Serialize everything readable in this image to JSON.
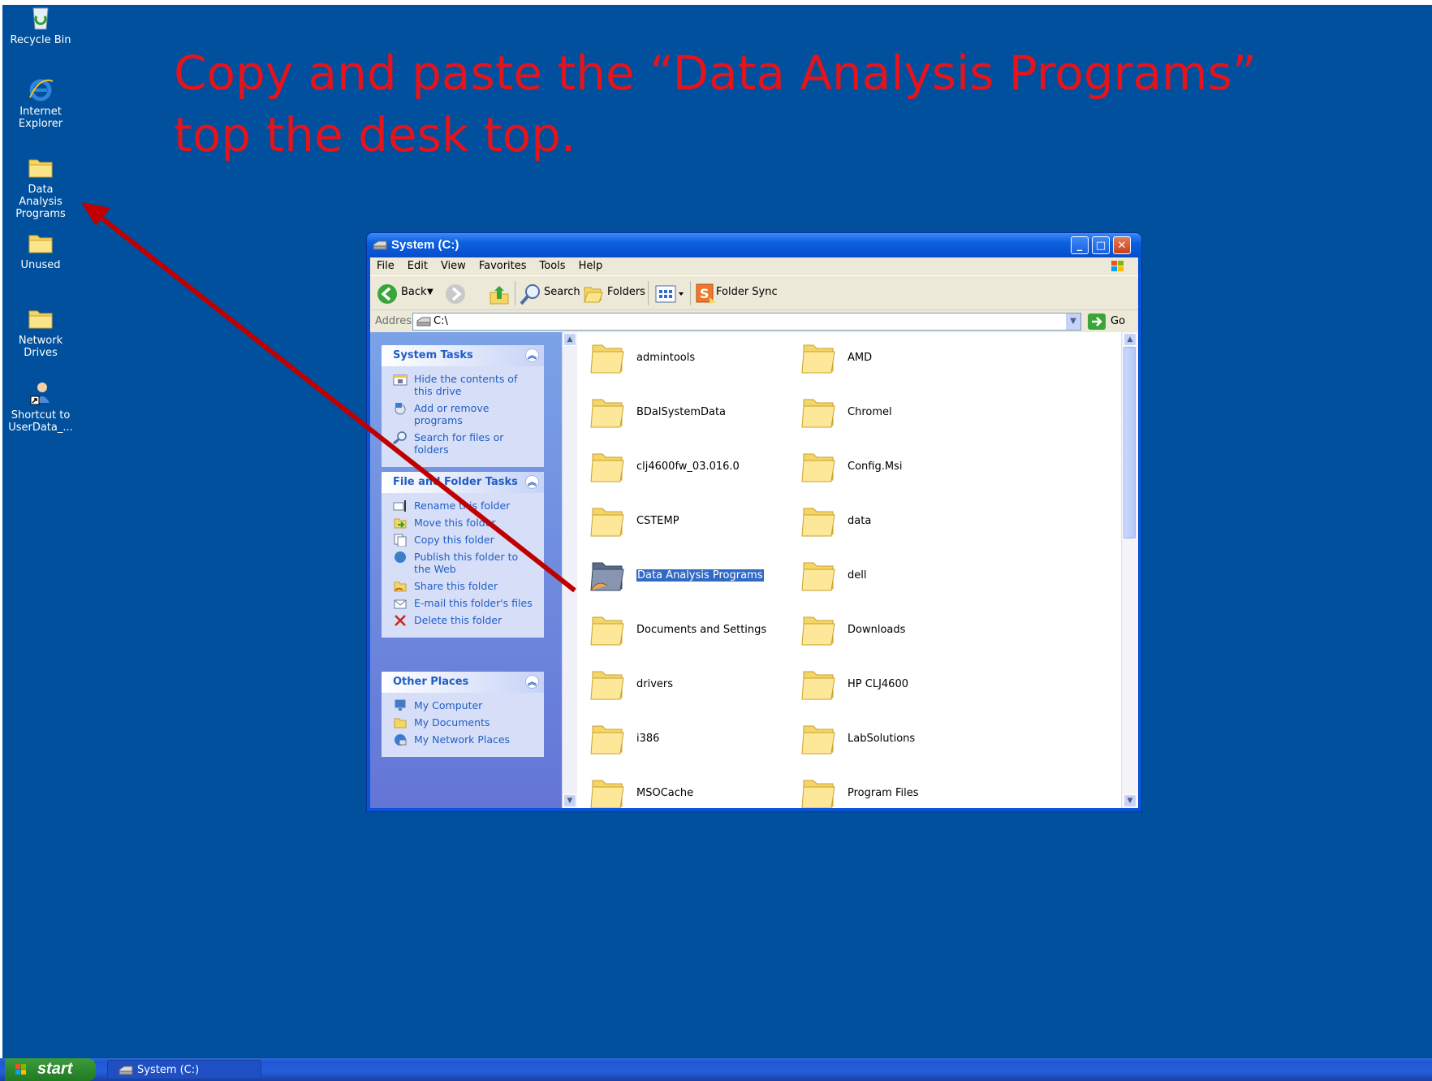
{
  "instruction": "Copy and paste the “Data Analysis Programs” top the desk top.",
  "desktop_icons": [
    {
      "label": "Recycle Bin",
      "icon": "recycle-bin-icon"
    },
    {
      "label": "Internet Explorer",
      "icon": "internet-explorer-icon"
    },
    {
      "label": "Data Analysis Programs",
      "icon": "folder-icon"
    },
    {
      "label": "Unused",
      "icon": "folder-icon"
    },
    {
      "label": "Network Drives",
      "icon": "folder-icon"
    },
    {
      "label": "Shortcut to UserData_...",
      "icon": "shortcut-icon"
    }
  ],
  "window": {
    "title": "System (C:)",
    "menu": [
      "File",
      "Edit",
      "View",
      "Favorites",
      "Tools",
      "Help"
    ],
    "toolbar": {
      "back": "Back",
      "search": "Search",
      "folders": "Folders",
      "folder_sync": "Folder Sync"
    },
    "address": {
      "label": "Address",
      "value": "C:\\",
      "go": "Go"
    },
    "panels": [
      {
        "title": "System Tasks",
        "links": [
          "Hide the contents of this drive",
          "Add or remove programs",
          "Search for files or folders"
        ]
      },
      {
        "title": "File and Folder Tasks",
        "links": [
          "Rename this folder",
          "Move this folder",
          "Copy this folder",
          "Publish this folder to the Web",
          "Share this folder",
          "E-mail this folder's files",
          "Delete this folder"
        ]
      },
      {
        "title": "Other Places",
        "links": [
          "My Computer",
          "My Documents",
          "My Network Places"
        ]
      }
    ],
    "files": [
      "admintools",
      "AMD",
      "BDalSystemData",
      "Chromel",
      "clj4600fw_03.016.0",
      "Config.Msi",
      "CSTEMP",
      "data",
      "Data Analysis Programs",
      "dell",
      "Documents and Settings",
      "Downloads",
      "drivers",
      "HP CLJ4600",
      "i386",
      "LabSolutions",
      "MSOCache",
      "Program Files"
    ],
    "selected_file": "Data Analysis Programs"
  },
  "taskbar": {
    "start": "start",
    "task": "System (C:)"
  },
  "colors": {
    "desktop": "#00509d",
    "instruction": "#e4141c",
    "arrow": "#c00000",
    "selection": "#316ac5"
  }
}
